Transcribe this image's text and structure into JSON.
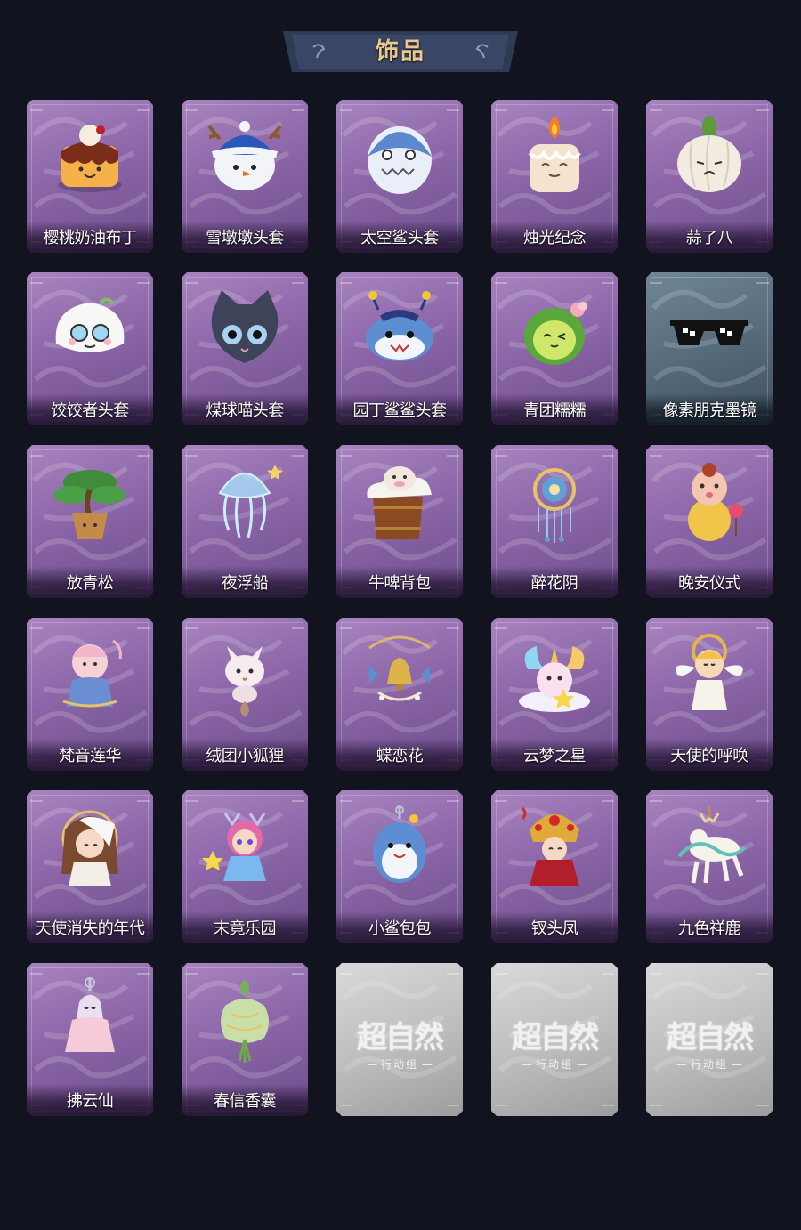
{
  "page": {
    "title": "饰品"
  },
  "items": [
    {
      "name": "樱桃奶油布丁",
      "icon": "pudding-icon",
      "bg": "purple",
      "art": "pudding"
    },
    {
      "name": "雪墩墩头套",
      "icon": "snowman-head-icon",
      "bg": "purple",
      "art": "snowman"
    },
    {
      "name": "太空鲨头套",
      "icon": "space-shark-head-icon",
      "bg": "purple",
      "art": "shark"
    },
    {
      "name": "烛光纪念",
      "icon": "candle-icon",
      "bg": "purple",
      "art": "candle"
    },
    {
      "name": "蒜了八",
      "icon": "garlic-icon",
      "bg": "purple",
      "art": "garlic"
    },
    {
      "name": "饺饺者头套",
      "icon": "dumpling-head-icon",
      "bg": "purple",
      "art": "dumpling"
    },
    {
      "name": "煤球喵头套",
      "icon": "black-cat-head-icon",
      "bg": "purple",
      "art": "cat"
    },
    {
      "name": "园丁鲨鲨头套",
      "icon": "gardener-shark-head-icon",
      "bg": "purple",
      "art": "shark2"
    },
    {
      "name": "青团糯糯",
      "icon": "green-rice-ball-icon",
      "bg": "purple",
      "art": "greenball"
    },
    {
      "name": "像素朋克墨镜",
      "icon": "pixel-sunglasses-icon",
      "bg": "steel",
      "art": "glasses"
    },
    {
      "name": "放青松",
      "icon": "pine-bonsai-icon",
      "bg": "purple",
      "art": "pine"
    },
    {
      "name": "夜浮船",
      "icon": "jellyfish-icon",
      "bg": "purple",
      "art": "jelly"
    },
    {
      "name": "牛啤背包",
      "icon": "cow-beer-backpack-icon",
      "bg": "purple",
      "art": "beer"
    },
    {
      "name": "醉花阴",
      "icon": "flower-ornament-icon",
      "bg": "purple",
      "art": "ornament"
    },
    {
      "name": "晚安仪式",
      "icon": "goodnight-doll-icon",
      "bg": "purple",
      "art": "doll"
    },
    {
      "name": "梵音莲华",
      "icon": "lotus-figure-icon",
      "bg": "purple",
      "art": "lotus"
    },
    {
      "name": "绒团小狐狸",
      "icon": "fox-plush-icon",
      "bg": "purple",
      "art": "fox"
    },
    {
      "name": "蝶恋花",
      "icon": "butterfly-bell-icon",
      "bg": "purple",
      "art": "bell"
    },
    {
      "name": "云梦之星",
      "icon": "unicorn-cloud-icon",
      "bg": "purple",
      "art": "unicorn"
    },
    {
      "name": "天使的呼唤",
      "icon": "angel-figure-icon",
      "bg": "purple",
      "art": "angel"
    },
    {
      "name": "天使消失的年代",
      "icon": "angel-girl-icon",
      "bg": "purple",
      "art": "angelgirl"
    },
    {
      "name": "末竟乐园",
      "icon": "paradise-girl-icon",
      "bg": "purple",
      "art": "girl"
    },
    {
      "name": "小鲨包包",
      "icon": "shark-bag-icon",
      "bg": "purple",
      "art": "sharkbag"
    },
    {
      "name": "钗头凤",
      "icon": "phoenix-crown-icon",
      "bg": "purple",
      "art": "phoenix"
    },
    {
      "name": "九色祥鹿",
      "icon": "deer-charm-icon",
      "bg": "purple",
      "art": "deer"
    },
    {
      "name": "拂云仙",
      "icon": "cloud-fairy-icon",
      "bg": "purple",
      "art": "fairy"
    },
    {
      "name": "春信香囊",
      "icon": "sachet-icon",
      "bg": "purple",
      "art": "sachet"
    }
  ],
  "placeholders": [
    {
      "main": "超自然",
      "sub": "行动组",
      "icon": "placeholder-logo-icon"
    },
    {
      "main": "超自然",
      "sub": "行动组",
      "icon": "placeholder-logo-icon"
    },
    {
      "main": "超自然",
      "sub": "行动组",
      "icon": "placeholder-logo-icon"
    }
  ]
}
